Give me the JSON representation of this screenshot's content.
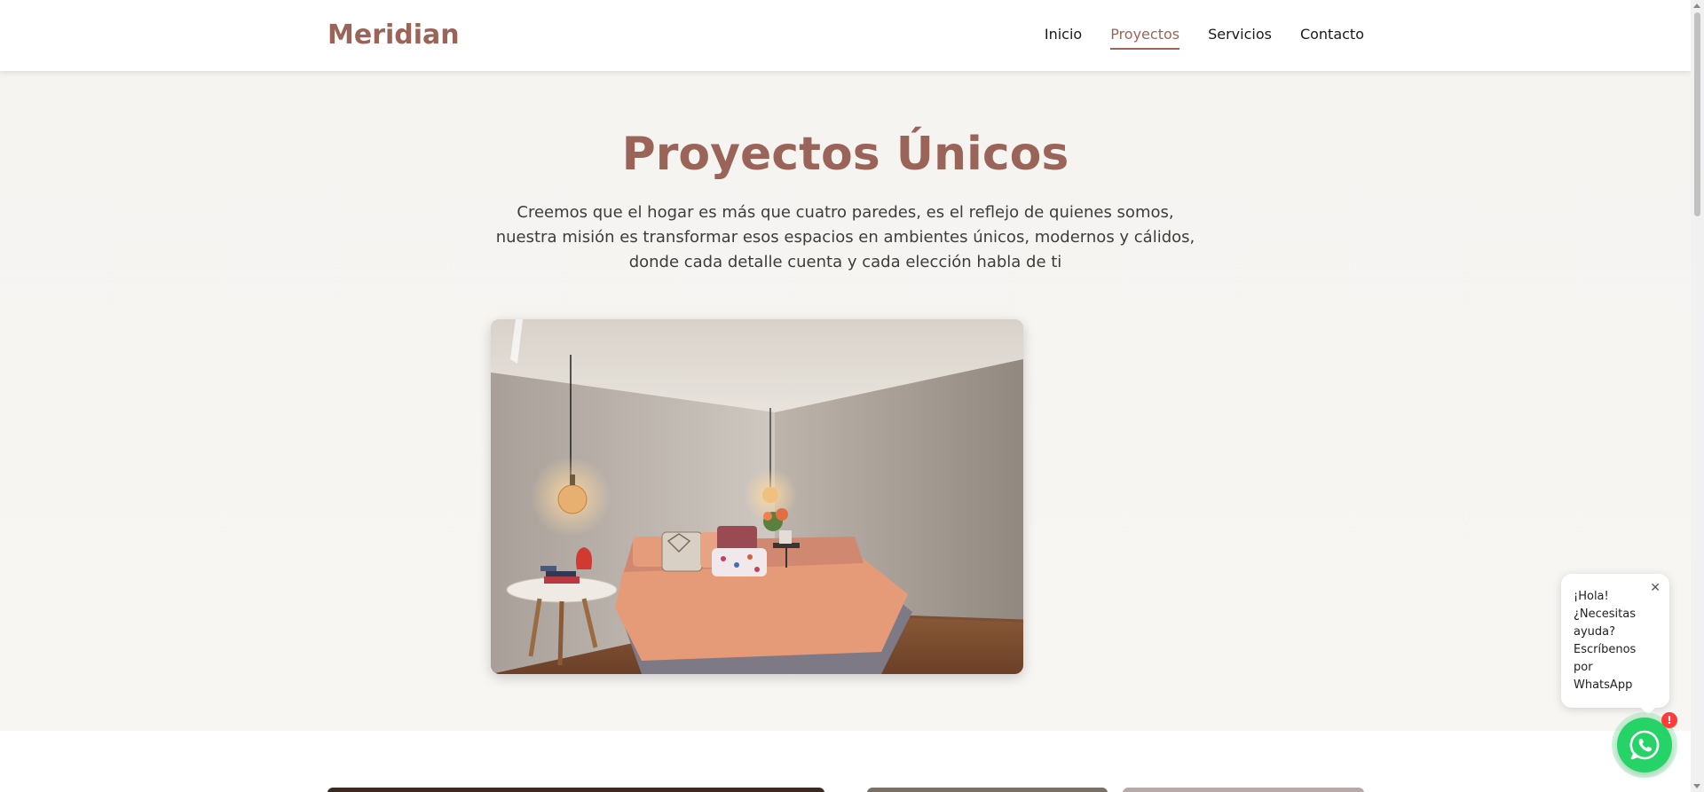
{
  "brand": {
    "name": "Meridian",
    "color": "#9a6459"
  },
  "nav": {
    "items": [
      {
        "label": "Inicio",
        "active": false
      },
      {
        "label": "Proyectos",
        "active": true
      },
      {
        "label": "Servicios",
        "active": false
      },
      {
        "label": "Contacto",
        "active": false
      }
    ]
  },
  "hero": {
    "title": "Proyectos Únicos",
    "description": "Creemos que el hogar es más que cuatro paredes, es el reflejo de quienes somos, nuestra misión es transformar esos espacios en ambientes únicos, modernos y cálidos, donde cada detalle cuenta y cada elección habla de ti"
  },
  "whatsapp": {
    "message": "¡Hola! ¿Necesitas ayuda? Escríbenos por WhatsApp",
    "close_glyph": "✕",
    "badge": "!",
    "color": "#25d366"
  }
}
